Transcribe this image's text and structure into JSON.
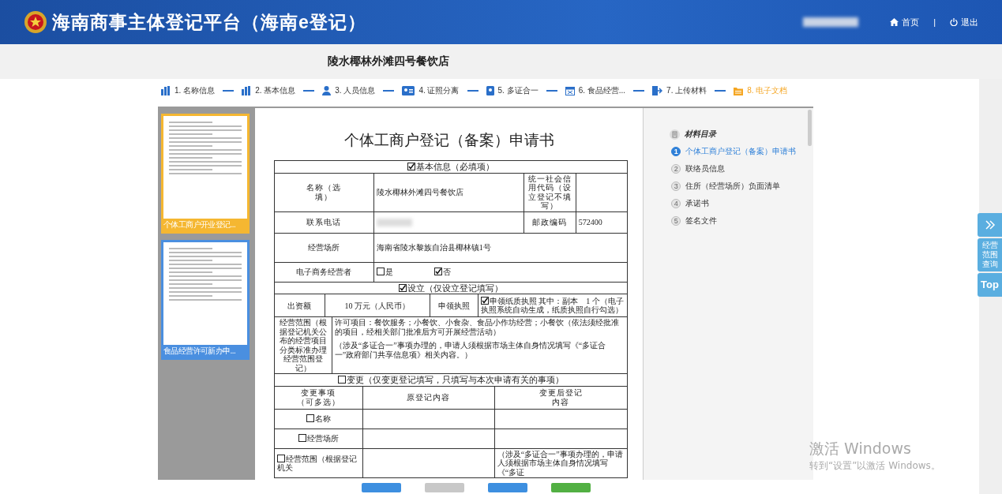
{
  "header": {
    "title": "海南商事主体登记平台（海南e登记）",
    "user_blurred": true,
    "separator": "|",
    "links": [
      {
        "kind": "home",
        "label": "首页"
      },
      {
        "kind": "power",
        "label": "退出"
      }
    ]
  },
  "shop_name": "陵水椰林外滩四号餐饮店",
  "steps": [
    {
      "kind": "bars",
      "label": "1. 名称信息",
      "selected": false
    },
    {
      "kind": "bars",
      "label": "2. 基本信息",
      "selected": false
    },
    {
      "kind": "person",
      "label": "3. 人员信息",
      "selected": false
    },
    {
      "kind": "card",
      "label": "4. 证照分离",
      "selected": false
    },
    {
      "kind": "badge",
      "label": "5. 多证合一",
      "selected": false
    },
    {
      "kind": "calendar",
      "label": "6. 食品经营...",
      "selected": false
    },
    {
      "kind": "exit",
      "label": "7. 上传材料",
      "selected": false
    },
    {
      "kind": "folder",
      "label": "8. 电子文档",
      "selected": true
    }
  ],
  "thumbnails": [
    {
      "caption": "个体工商户开业登记...",
      "selected": true
    },
    {
      "caption": "食品经营许可新办申...",
      "selected": false
    }
  ],
  "document": {
    "title": "个体工商户登记（备案）申请书",
    "rows": [
      {
        "kind": "section",
        "checked": true,
        "label": "基本信息（必填项）"
      },
      {
        "kind": "quad",
        "label": "名称（选填）",
        "value": "陵水椰林外滩四号餐饮店",
        "label2": "统一社会信用代码（设立登记不填写）"
      },
      {
        "kind": "quad",
        "label": "联系电话",
        "value_blurred": true,
        "label2": "邮政编码",
        "value2": "572400"
      },
      {
        "kind": "wide",
        "label": "经营场所",
        "value": "海南省陵水黎族自治县椰林镇1号"
      },
      {
        "kind": "options",
        "label": "电子商务经营者",
        "options": [
          {
            "label": "是",
            "checked": false
          },
          {
            "label": "否",
            "checked": true
          }
        ]
      },
      {
        "kind": "section",
        "checked": true,
        "label": "设立（仅设立登记填写）"
      },
      {
        "kind": "investment",
        "label": "出资额",
        "value": "10 万元（人民币）",
        "label2": "申领执照",
        "option": {
          "label": "申领纸质执照 其中：副本　1 个（电子执照系统自动生成，纸质执照自行勾选）",
          "checked": true
        }
      },
      {
        "kind": "scope",
        "label": "经营范围（根据登记机关公布的经营项目分类标准办理经营范围登记）",
        "paragraphs": [
          "许可项目：餐饮服务；小餐饮、小食杂、食品小作坊经营；小餐饮（依法须经批准的项目，经相关部门批准后方可开展经营活动）",
          "（涉及“多证合一”事项办理的，申请人须根据市场主体自身情况填写《“多证合一”政府部门共享信息项》相关内容。）"
        ]
      },
      {
        "kind": "section",
        "checked": false,
        "label": "变更（仅变更登记填写，只填写与本次申请有关的事项）"
      },
      {
        "kind": "change_head",
        "cells": [
          "变更事项（可多选）",
          "原登记内容",
          "变更后登记内容"
        ]
      },
      {
        "kind": "change",
        "option": {
          "label": "名称",
          "checked": false
        }
      },
      {
        "kind": "change",
        "option": {
          "label": "经营场所",
          "checked": false
        }
      },
      {
        "kind": "change",
        "option": {
          "label": "经营范围（根据登记机关",
          "checked": false
        },
        "note": "（涉及“多证合一”事项办理的，申请人须根据市场主体自身情况填写《“多证"
      }
    ]
  },
  "catalog": {
    "title": "材料目录",
    "items": [
      {
        "number": "1",
        "label": "个体工商户登记（备案）申请书",
        "selected": true
      },
      {
        "number": "2",
        "label": "联络员信息",
        "selected": false
      },
      {
        "number": "3",
        "label": "住所（经营场所）负面清单",
        "selected": false
      },
      {
        "number": "4",
        "label": "承诺书",
        "selected": false
      },
      {
        "number": "5",
        "label": "签名文件",
        "selected": false
      }
    ]
  },
  "bottom_buttons": [
    {
      "color": "#3d8fe0"
    },
    {
      "color": "#c8c8c8"
    },
    {
      "color": "#3d8fe0"
    },
    {
      "color": "#52b043"
    }
  ],
  "float_tools": [
    {
      "kind": "expand"
    },
    {
      "kind": "text",
      "label": "经营范围查询"
    },
    {
      "kind": "text",
      "label": "Top"
    }
  ],
  "os_notice": {
    "title": "激活 Windows",
    "subtitle": "转到“设置”以激活 Windows。"
  }
}
